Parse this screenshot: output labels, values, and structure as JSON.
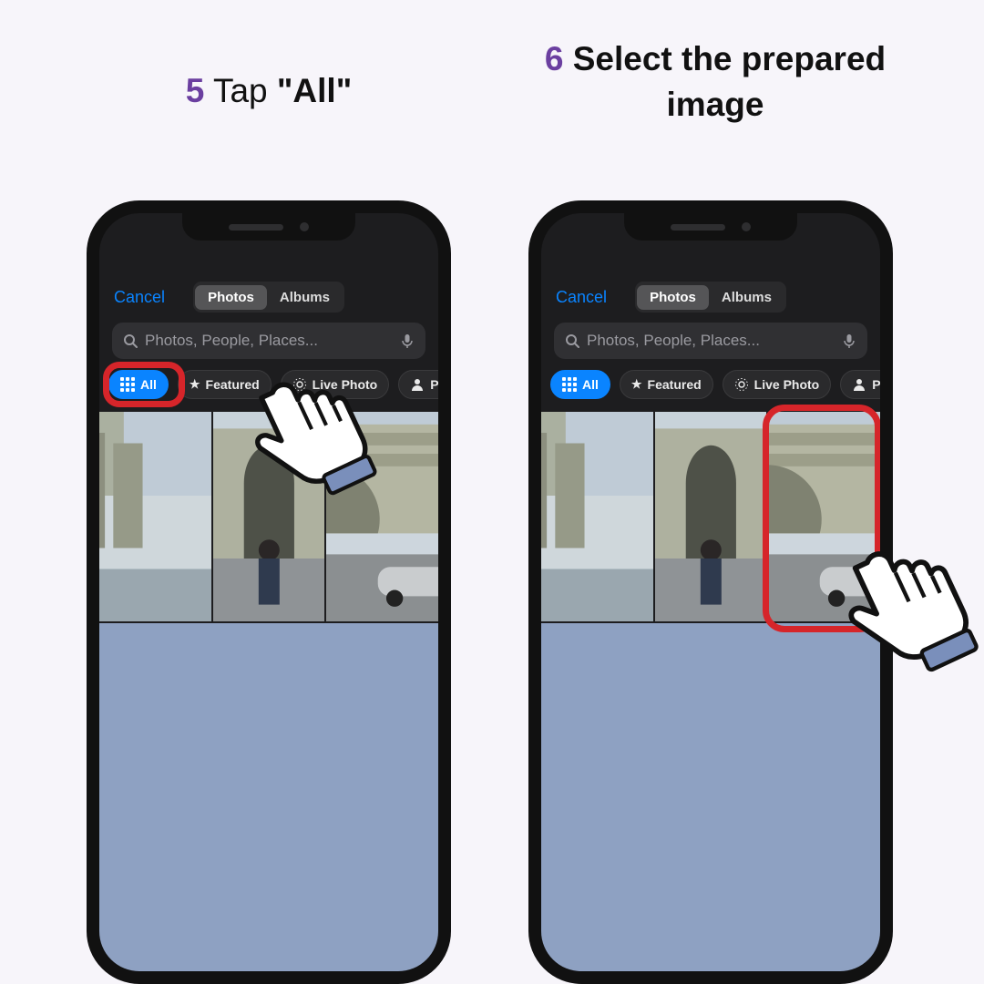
{
  "step5": {
    "num": "5",
    "before": "Tap ",
    "quote_open": "\"",
    "bold": "All",
    "quote_close": "\""
  },
  "step6": {
    "num": "6",
    "text": "Select the prepared image"
  },
  "picker": {
    "cancel": "Cancel",
    "seg_photos": "Photos",
    "seg_albums": "Albums",
    "search_placeholder": "Photos, People, Places...",
    "chips": {
      "all": "All",
      "featured": "Featured",
      "live": "Live Photo",
      "people": "Peop"
    }
  },
  "colors": {
    "accent_purple": "#6b3fa0",
    "ios_blue": "#0a84ff",
    "highlight_red": "#d6252a"
  }
}
